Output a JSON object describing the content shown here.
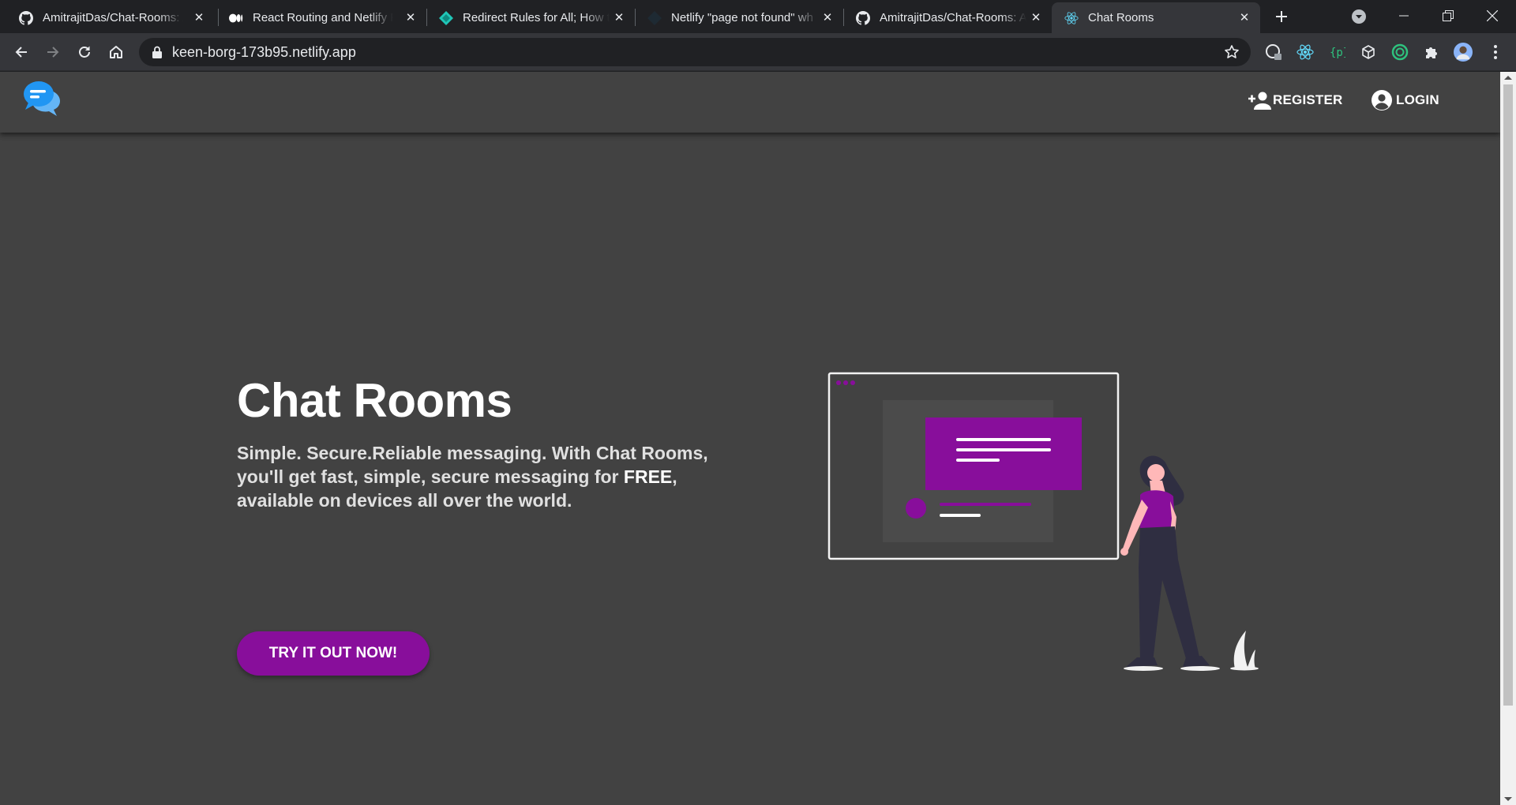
{
  "browser": {
    "tabs": [
      {
        "title": "AmitrajitDas/Chat-Rooms: A",
        "icon": "github-icon",
        "active": false
      },
      {
        "title": "React Routing and Netlify R",
        "icon": "medium-icon",
        "active": false
      },
      {
        "title": "Redirect Rules for All; How t",
        "icon": "netlify-icon",
        "active": false
      },
      {
        "title": "Netlify \"page not found\" wh",
        "icon": "netlify-dark-icon",
        "active": false
      },
      {
        "title": "AmitrajitDas/Chat-Rooms: A",
        "icon": "github-icon",
        "active": false
      },
      {
        "title": "Chat Rooms",
        "icon": "react-icon",
        "active": true
      }
    ],
    "address": "keen-borg-173b95.netlify.app"
  },
  "navbar": {
    "register_label": "REGISTER",
    "login_label": "LOGIN"
  },
  "hero": {
    "title": "Chat Rooms",
    "text_before": "Simple. Secure.Reliable messaging. With Chat Rooms, you'll get fast, simple, secure messaging for ",
    "text_emphasis": "FREE",
    "text_after": ", available on devices all over the world.",
    "cta_label": "TRY IT OUT NOW!"
  },
  "colors": {
    "accent": "#880e9b",
    "background": "#424242",
    "logo_blue": "#2196f3"
  }
}
